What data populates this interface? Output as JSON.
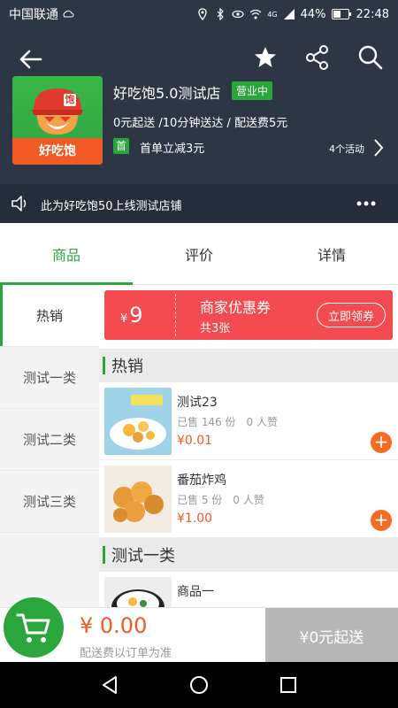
{
  "status_bar": {
    "carrier": "中国联通",
    "battery": "44%",
    "time": "22:48",
    "network": "4G"
  },
  "header": {
    "shop_name": "好吃饱5.0测试店",
    "status_badge": "营业中",
    "meta": "0元起送 /10分钟送达 / 配送费5元",
    "promo_badge": "首",
    "promo_text": "首单立减3元",
    "activity_count": "4个活动",
    "logo_text": "好吃饱",
    "logo_badge": "饱"
  },
  "notice": {
    "text": "此为好吃饱50上线测试店铺"
  },
  "tabs": [
    {
      "label": "商品",
      "active": true
    },
    {
      "label": "评价",
      "active": false
    },
    {
      "label": "详情",
      "active": false
    }
  ],
  "categories": [
    {
      "label": "热销",
      "active": true
    },
    {
      "label": "测试一类",
      "active": false
    },
    {
      "label": "测试二类",
      "active": false
    },
    {
      "label": "测试三类",
      "active": false
    }
  ],
  "coupon": {
    "currency": "¥",
    "amount": "9",
    "title": "商家优惠券",
    "count": "共3张",
    "button": "立即领券"
  },
  "sections": [
    {
      "title": "热销"
    },
    {
      "title": "测试一类"
    }
  ],
  "items": [
    {
      "name": "测试23",
      "sales": "已售 146 份　0 人赞",
      "price": "¥0.01"
    },
    {
      "name": "番茄炸鸡",
      "sales": "已售 5 份　0 人赞",
      "price": "¥1.00"
    },
    {
      "name": "商品一",
      "sales": "",
      "price": ""
    }
  ],
  "cart": {
    "total": "¥ 0.00",
    "note": "配送费以订单为准",
    "checkout": "¥0元起送"
  },
  "colors": {
    "header_bg": "#2d3645",
    "accent_green": "#2aa63c",
    "coupon_red": "#f44b50",
    "price_orange": "#f15a24"
  }
}
